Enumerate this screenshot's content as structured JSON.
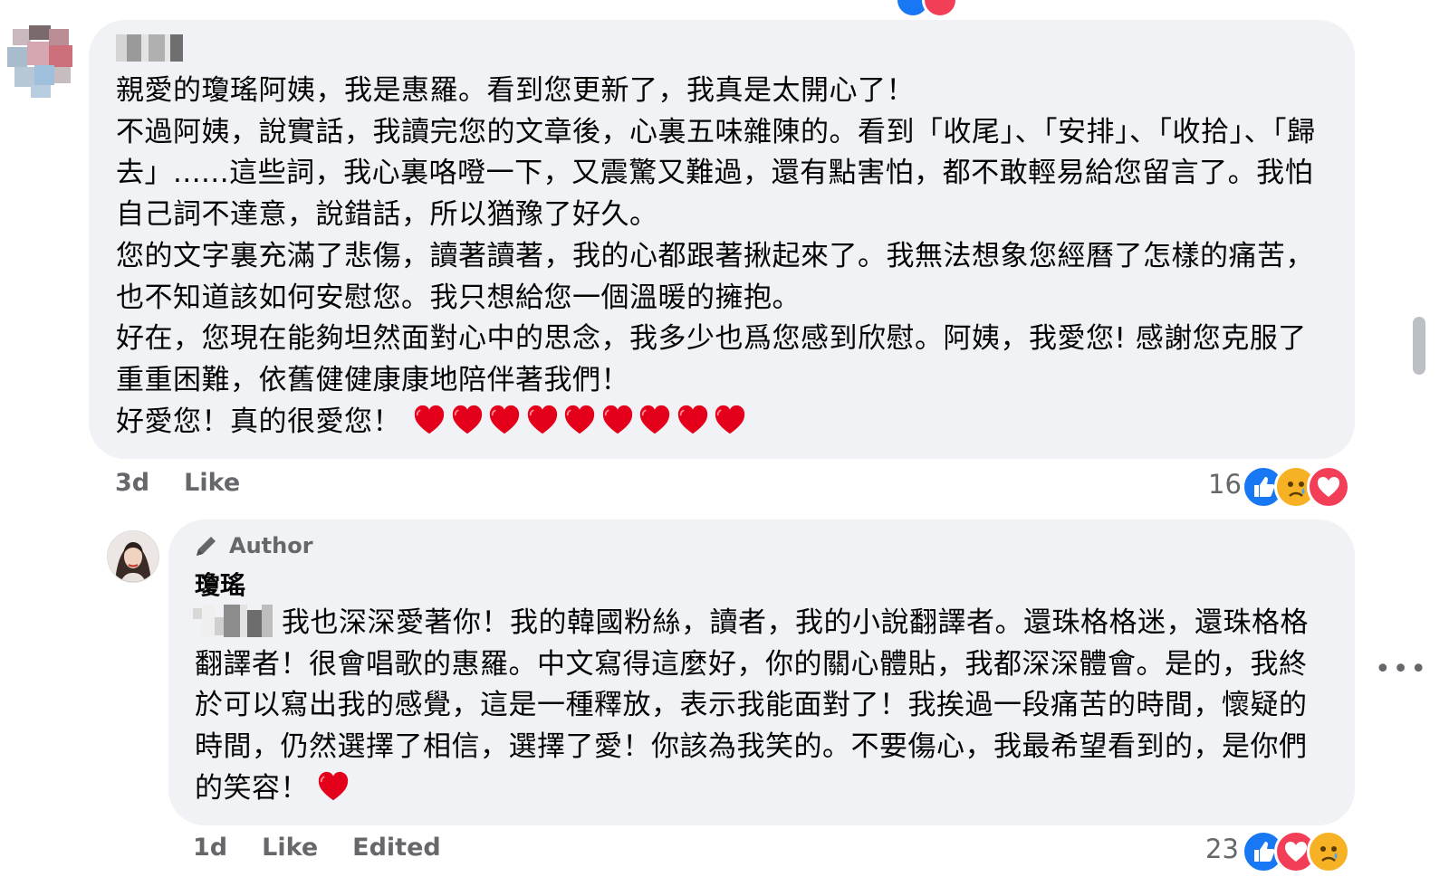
{
  "comment1": {
    "lines": [
      "親愛的瓊瑤阿姨，我是惠羅。看到您更新了，我真是太開心了！",
      "不過阿姨，說實話，我讀完您的文章後，心裏五味雜陳的。看到「收尾」、「安排」、「收拾」、「歸去」......這些詞，我心裏咯噔一下，又震驚又難過，還有點害怕，都不敢輕易給您留言了。我怕自己詞不達意，說錯話，所以猶豫了好久。",
      "您的文字裏充滿了悲傷，讀著讀著，我的心都跟著揪起來了。我無法想象您經曆了怎樣的痛苦，也不知道該如何安慰您。我只想給您一個溫暖的擁抱。",
      "好在，您現在能夠坦然面對心中的思念，我多少也爲您感到欣慰。阿姨，我愛您! 感謝您克服了重重困難，依舊健健康康地陪伴著我們！"
    ],
    "last_line": "好愛您！真的很愛您！",
    "heart_count": 9,
    "time": "3d",
    "like_label": "Like",
    "reaction_count": "16",
    "reactions": [
      "like-icon",
      "sad-icon",
      "love-icon"
    ]
  },
  "reply": {
    "author_badge": "Author",
    "author_name": "瓊瑤",
    "text": "我也深深愛著你！我的韓國粉絲，讀者，我的小說翻譯者。還珠格格迷，還珠格格翻譯者！很會唱歌的惠羅。中文寫得這麼好，你的關心體貼，我都深深體會。是的，我終於可以寫出我的感覺，這是一種釋放，表示我能面對了！我挨過一段痛苦的時間，懷疑的時間，仍然選擇了相信，選擇了愛！你該為我笑的。不要傷心，我最希望看到的，是你們的笑容！",
    "time": "1d",
    "like_label": "Like",
    "edited_label": "Edited",
    "reaction_count": "23",
    "reactions": [
      "like-icon",
      "love-icon",
      "sad-icon"
    ]
  },
  "more_options": "•••",
  "colors": {
    "bubble_bg": "#f0f2f5",
    "meta_text": "#65676b",
    "like_blue": "#1877f2",
    "love_red": "#f33e58",
    "heart_red": "#e4001b",
    "sad_yellow": "#f7b125"
  }
}
